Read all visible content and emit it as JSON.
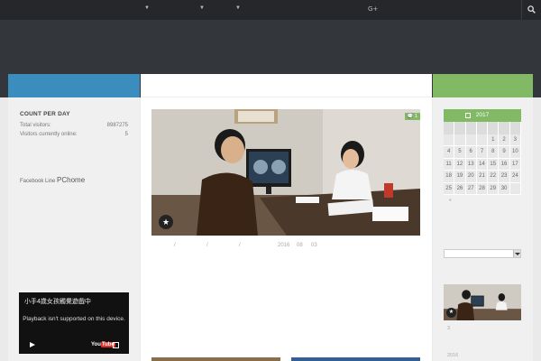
{
  "nav": {
    "items": [
      "",
      "",
      ""
    ],
    "gplus": "G+",
    "search_icon": "search-icon"
  },
  "left": {
    "widget_title": "COUNT PER DAY",
    "stats": [
      {
        "label": "Total visitors:",
        "value": "8987275"
      },
      {
        "label": "Visitors currently online:",
        "value": "5"
      }
    ],
    "social": {
      "facebook": "Facebook",
      "line": "Line",
      "pchome": "PChome"
    },
    "video": {
      "title": "小手4歲女孩觸覺遊戲中",
      "message": "Playback isn't supported on this device.",
      "youtube_label_a": "You",
      "youtube_label_b": "Tube"
    }
  },
  "main": {
    "comment_count": "1",
    "meta": {
      "year": "2016",
      "month": "08",
      "day": "03"
    }
  },
  "right": {
    "calendar": {
      "year": "2017",
      "dow": [
        "",
        "",
        "",
        "",
        "",
        "",
        ""
      ],
      "weeks": [
        [
          "",
          "",
          "",
          "",
          "1",
          "2",
          "3"
        ],
        [
          "4",
          "5",
          "6",
          "7",
          "8",
          "9",
          "10"
        ],
        [
          "11",
          "12",
          "13",
          "14",
          "15",
          "16",
          "17"
        ],
        [
          "18",
          "19",
          "20",
          "21",
          "22",
          "23",
          "24"
        ],
        [
          "25",
          "26",
          "27",
          "28",
          "29",
          "30",
          ""
        ]
      ],
      "prev": "«"
    },
    "post_meta_a": "3",
    "post_meta_b": "2016"
  },
  "colors": {
    "blue": "#3b8dbd",
    "green": "#82b965",
    "dark": "#33363b"
  }
}
